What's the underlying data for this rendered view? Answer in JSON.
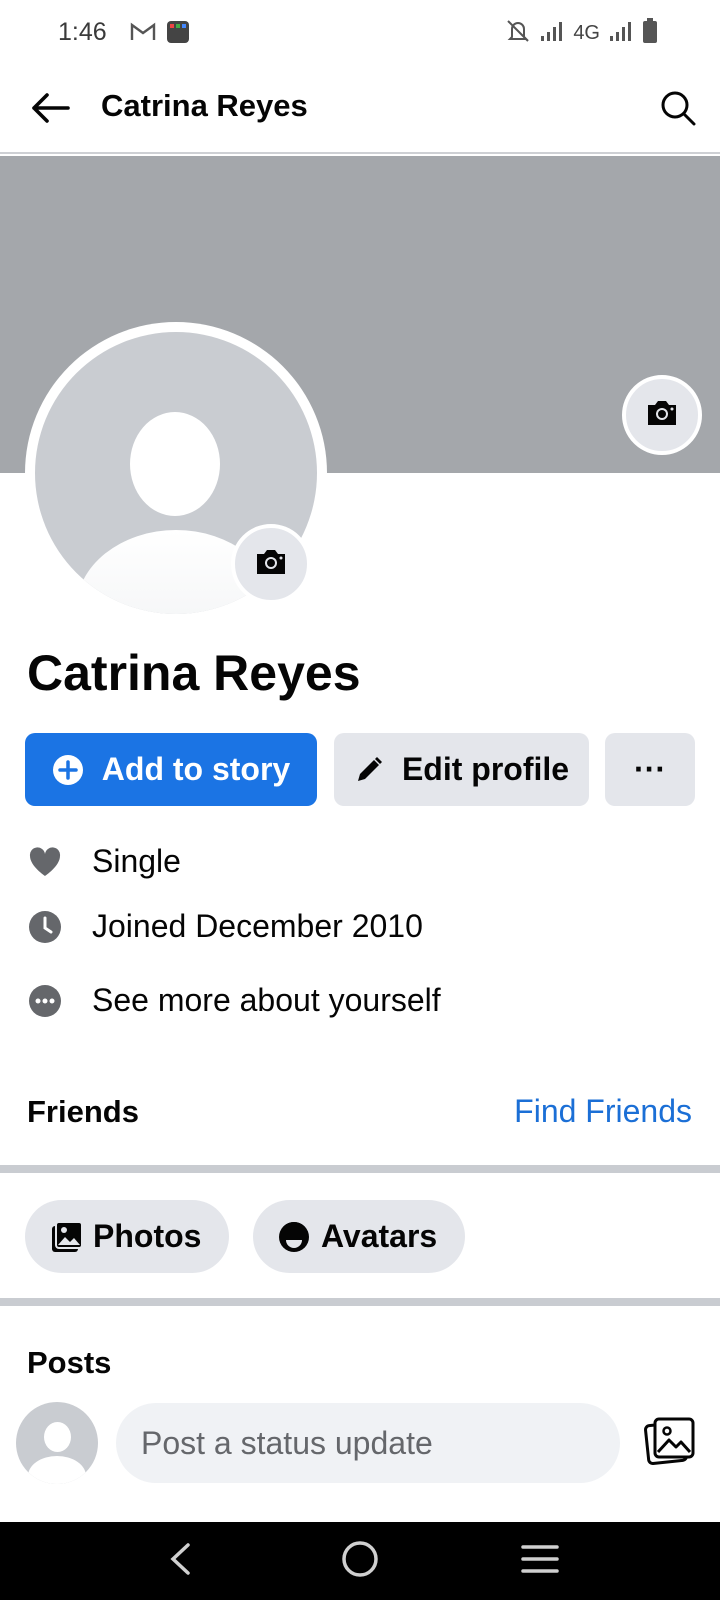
{
  "status_bar": {
    "time": "1:46",
    "network": "4G",
    "icons": [
      "gmail-icon",
      "app-grid-icon",
      "mute-icon",
      "signal-icon",
      "battery-icon"
    ]
  },
  "app_bar": {
    "title": "Catrina Reyes",
    "back_icon": "arrow-left-icon",
    "search_icon": "search-icon"
  },
  "profile": {
    "name": "Catrina Reyes",
    "cover_color": "#a4a7ab"
  },
  "actions": {
    "add_story": "Add to story",
    "edit_profile": "Edit profile",
    "more": "···"
  },
  "details": [
    {
      "icon": "heart-icon",
      "text": "Single"
    },
    {
      "icon": "clock-icon",
      "text": "Joined December 2010"
    },
    {
      "icon": "more-dots-icon",
      "text": "See more about yourself"
    }
  ],
  "friends": {
    "title": "Friends",
    "find_link": "Find Friends"
  },
  "media_tabs": [
    {
      "icon": "photos-icon",
      "label": "Photos"
    },
    {
      "icon": "avatar-face-icon",
      "label": "Avatars"
    }
  ],
  "posts": {
    "title": "Posts",
    "composer_placeholder": "Post a status update"
  },
  "colors": {
    "accent": "#1b74e4",
    "link": "#1b6fd6",
    "button_gray": "#e4e6eb"
  }
}
